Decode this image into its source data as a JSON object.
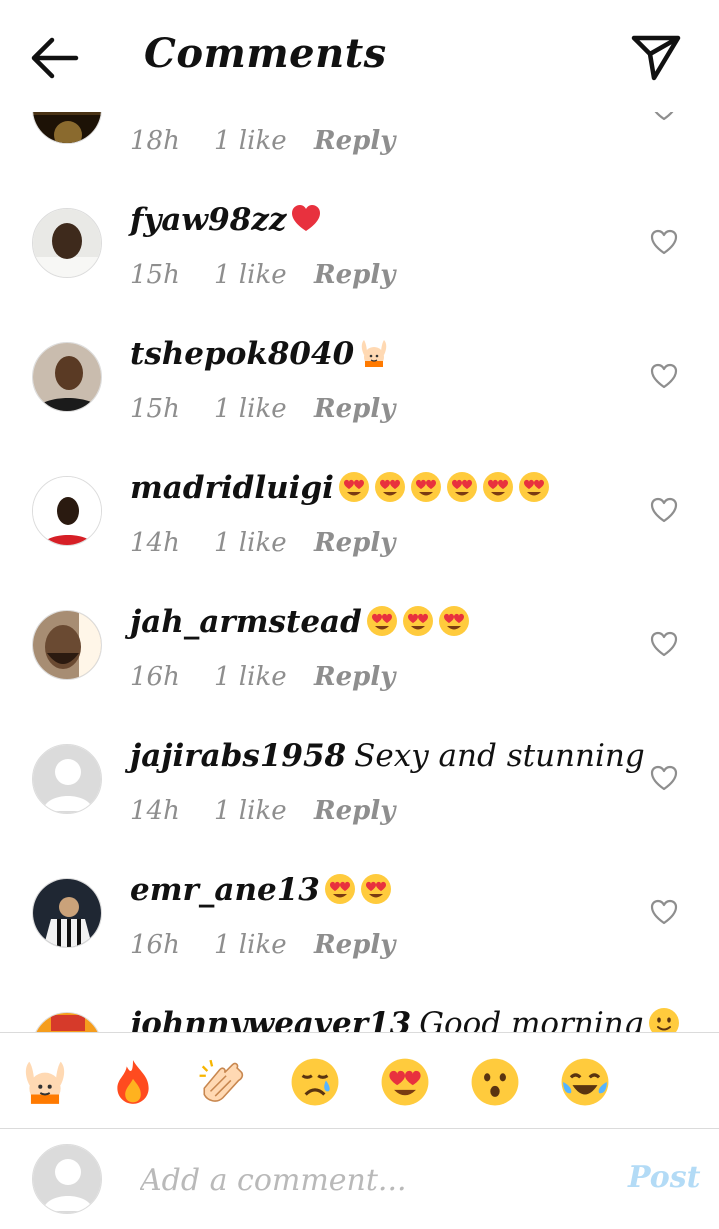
{
  "header": {
    "title": "Comments",
    "back_icon": "arrow-left-icon",
    "send_icon": "paper-plane-icon"
  },
  "comments": [
    {
      "username": "",
      "text": "",
      "emojis": [],
      "time": "18h",
      "likes": "1 like",
      "reply": "Reply",
      "avatar": "photo-dark"
    },
    {
      "username": "fyaw98zz",
      "text": "",
      "emojis": [
        "red-heart"
      ],
      "time": "15h",
      "likes": "1 like",
      "reply": "Reply",
      "avatar": "photo-man-light"
    },
    {
      "username": "tshepok8040",
      "text": "",
      "emojis": [
        "raising-hands"
      ],
      "time": "15h",
      "likes": "1 like",
      "reply": "Reply",
      "avatar": "photo-man-dark"
    },
    {
      "username": "madridluigi",
      "text": "",
      "emojis": [
        "heart-eyes",
        "heart-eyes",
        "heart-eyes",
        "heart-eyes",
        "heart-eyes",
        "heart-eyes"
      ],
      "time": "14h",
      "likes": "1 like",
      "reply": "Reply",
      "avatar": "photo-man-red"
    },
    {
      "username": "jah_armstead",
      "text": "",
      "emojis": [
        "heart-eyes",
        "heart-eyes",
        "heart-eyes"
      ],
      "time": "16h",
      "likes": "1 like",
      "reply": "Reply",
      "avatar": "photo-man-beard"
    },
    {
      "username": "jajirabs1958",
      "text": "Sexy and stunning",
      "emojis": [],
      "time": "14h",
      "likes": "1 like",
      "reply": "Reply",
      "avatar": "default"
    },
    {
      "username": "emr_ane13",
      "text": "",
      "emojis": [
        "heart-eyes",
        "heart-eyes"
      ],
      "time": "16h",
      "likes": "1 like",
      "reply": "Reply",
      "avatar": "photo-footballer"
    },
    {
      "username": "johnnyweaver13",
      "text": "Good morning",
      "emojis": [
        "slight-smile"
      ],
      "time": "",
      "likes": "",
      "reply": "",
      "avatar": "photo-colorful"
    }
  ],
  "reactions": [
    "raising-hands",
    "fire",
    "clapping-hands",
    "crying-face",
    "heart-eyes",
    "hushed-face",
    "tears-of-joy"
  ],
  "composer": {
    "placeholder": "Add a comment...",
    "post_label": "Post"
  },
  "colors": {
    "meta_gray": "#8e8e8e",
    "post_blue": "#b3dbf6",
    "divider": "#dbdbdb"
  }
}
